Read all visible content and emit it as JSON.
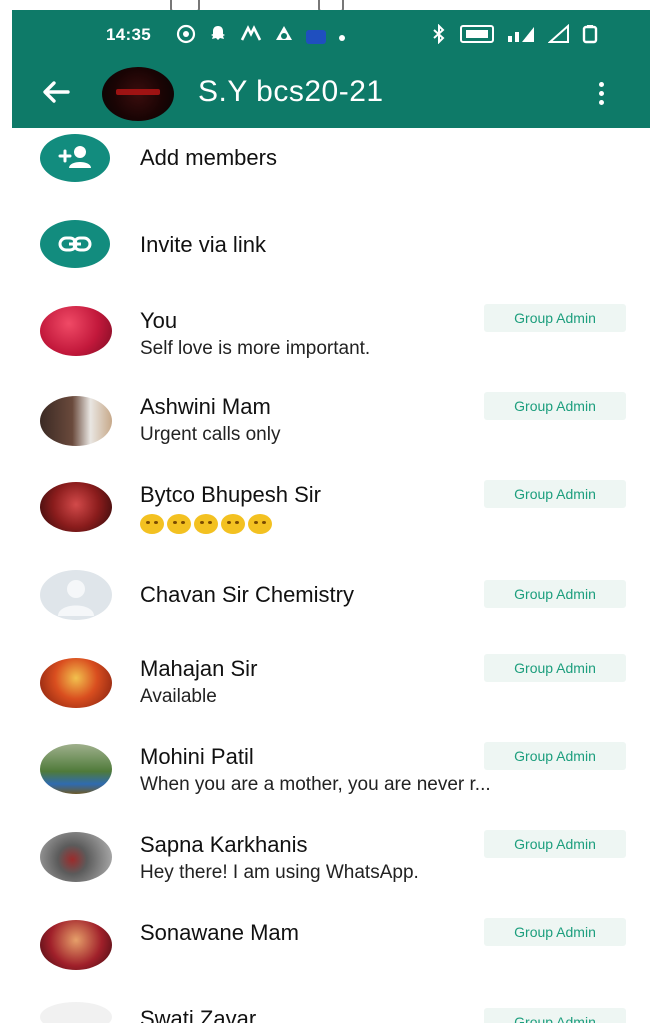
{
  "status_bar": {
    "time": "14:35",
    "left_icons": [
      "whatsapp-icon",
      "snapchat-icon",
      "share-icon",
      "drive-icon",
      "notification-dot-icon"
    ],
    "right_icons": [
      "bluetooth-icon",
      "volte-icon",
      "signal-icon",
      "wifi-icon",
      "battery-icon"
    ]
  },
  "header": {
    "group_name": "S.Y bcs20-21",
    "accent_color": "#0e7a68"
  },
  "actions": [
    {
      "label": "Add members",
      "icon": "add-person-icon"
    },
    {
      "label": "Invite via link",
      "icon": "link-icon"
    }
  ],
  "members": [
    {
      "name": "You",
      "status": "Self love is more important.",
      "badge": "Group Admin",
      "avatar": "#c2183b"
    },
    {
      "name": "Ashwini Mam",
      "status": "Urgent calls only",
      "badge": "Group Admin",
      "avatar": "#6a4a3c"
    },
    {
      "name": "Bytco Bhupesh Sir",
      "status": "",
      "badge": "Group Admin",
      "avatar": "#8a1c1c",
      "status_emojis": [
        "grimace-emoji",
        "grimace-emoji",
        "grimace-emoji",
        "grimace-emoji",
        "grimace-emoji"
      ]
    },
    {
      "name": "Chavan Sir Chemistry",
      "status": "",
      "badge": "Group Admin",
      "avatar": "#d8dee3"
    },
    {
      "name": "Mahajan Sir",
      "status": "Available",
      "badge": "Group Admin",
      "avatar": "#d94e1f"
    },
    {
      "name": "Mohini Patil",
      "status": "When you are a mother, you are never r...",
      "badge": "Group Admin",
      "avatar": "#4f7a3a"
    },
    {
      "name": "Sapna Karkhanis",
      "status": "Hey there! I am using WhatsApp.",
      "badge": "Group Admin",
      "avatar": "#5b5b5b"
    },
    {
      "name": "Sonawane Mam",
      "status": "",
      "badge": "Group Admin",
      "avatar": "#a0202a"
    },
    {
      "name": "Swati Zavar",
      "status": "",
      "badge": "Group Admin",
      "avatar": "#e9e9e9"
    }
  ]
}
